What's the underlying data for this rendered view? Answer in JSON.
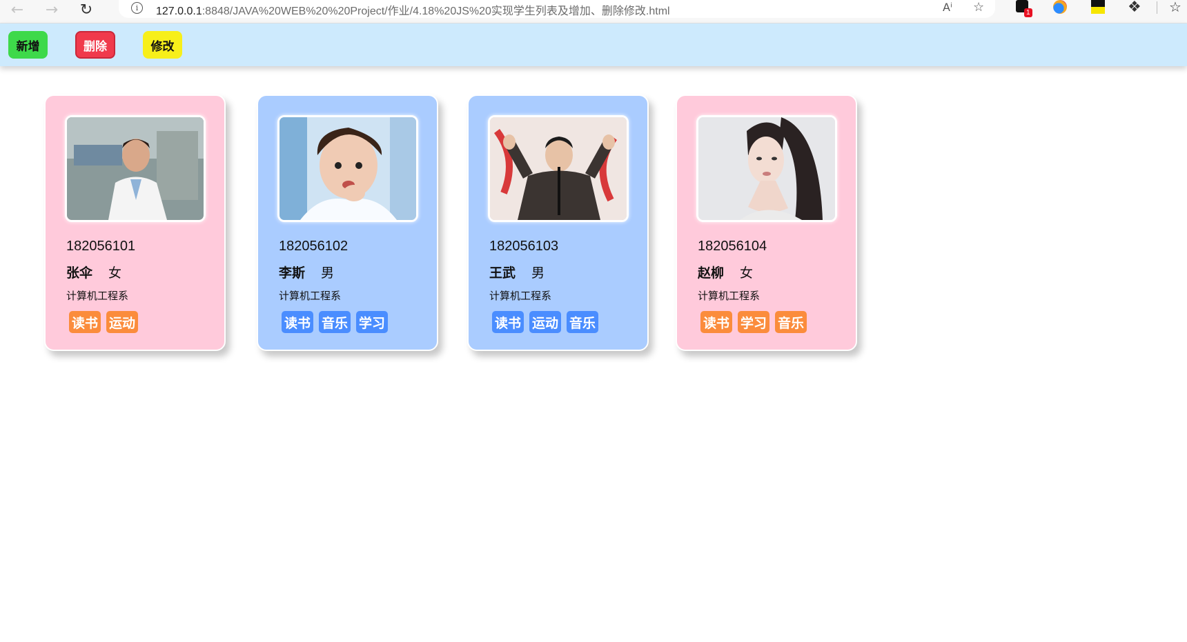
{
  "browser": {
    "url_prefix": "127.0.0.1",
    "url_rest": ":8848/JAVA%20WEB%20%20Project/作业/4.18%20JS%20实现学生列表及增加、删除修改.html",
    "extension_badge_count": "1"
  },
  "toolbar": {
    "add_label": "新增",
    "delete_label": "删除",
    "edit_label": "修改",
    "colors": {
      "add": "#3ed94a",
      "delete": "#f03a4c",
      "edit": "#f7ef1a"
    }
  },
  "students": [
    {
      "id": "182056101",
      "name": "张伞",
      "gender": "女",
      "dept": "计算机工程系",
      "tags": [
        "读书",
        "运动"
      ],
      "theme": "pink",
      "photo": "woman-doctor-photo"
    },
    {
      "id": "182056102",
      "name": "李斯",
      "gender": "男",
      "dept": "计算机工程系",
      "tags": [
        "读书",
        "音乐",
        "学习"
      ],
      "theme": "blue",
      "photo": "young-man-eating-photo"
    },
    {
      "id": "182056103",
      "name": "王武",
      "gender": "男",
      "dept": "计算机工程系",
      "tags": [
        "读书",
        "运动",
        "音乐"
      ],
      "theme": "blue",
      "photo": "performer-on-stage-photo"
    },
    {
      "id": "182056104",
      "name": "赵柳",
      "gender": "女",
      "dept": "计算机工程系",
      "tags": [
        "读书",
        "学习",
        "音乐"
      ],
      "theme": "pink",
      "photo": "woman-portrait-photo"
    }
  ],
  "theme_colors": {
    "pink_card": "#ffcadb",
    "blue_card": "#aaccff",
    "pink_tag": "#fb8c3c",
    "blue_tag": "#4a8dff"
  }
}
